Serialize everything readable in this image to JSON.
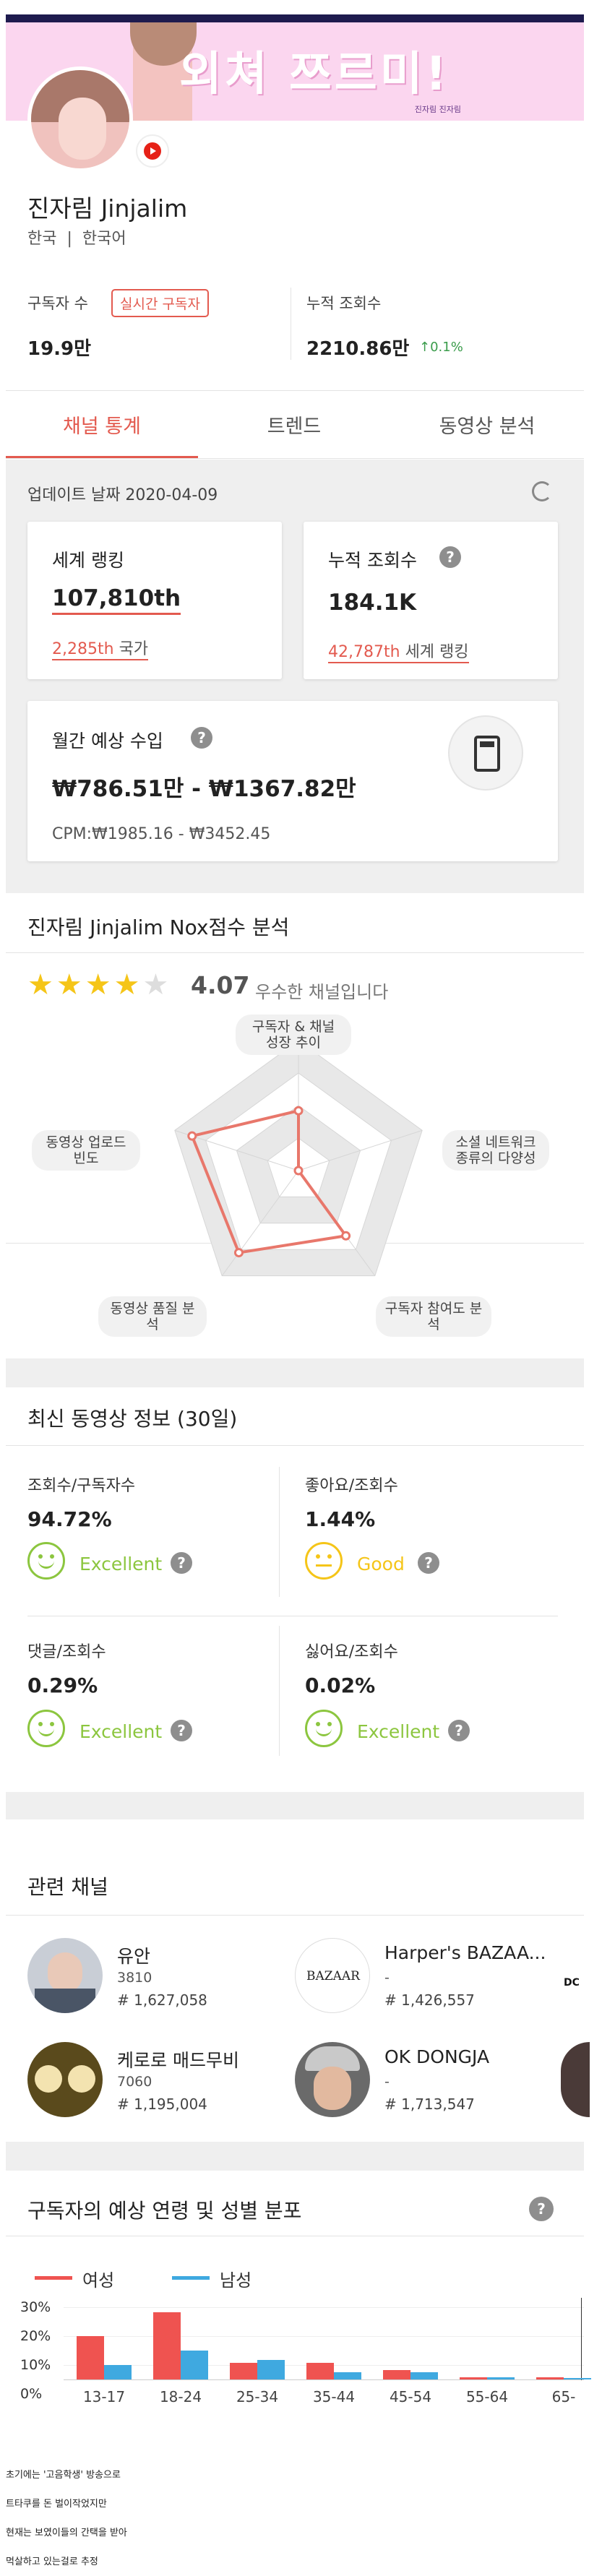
{
  "banner": {
    "title": "외쳐 쯔르미!",
    "social": "진자림 진자림"
  },
  "channel": {
    "name": "진자림 Jinjalim",
    "country": "한국",
    "language": "한국어"
  },
  "stats": {
    "subscribers_label": "구독자 수",
    "realtime_button": "실시간 구독자",
    "subscribers_value": "19.9만",
    "views_label": "누적 조회수",
    "views_value": "2210.86만",
    "views_growth": "0.1%"
  },
  "tabs": [
    "채널 통계",
    "트렌드",
    "동영상 분석"
  ],
  "overview": {
    "update_date": "업데이트 날짜 2020-04-09",
    "world_rank_title": "세계 랭킹",
    "world_rank_value": "107,810th",
    "country_rank_value": "2,285th",
    "country_rank_label": "국가",
    "views_title": "누적 조회수",
    "views_value": "184.1K",
    "views_rank_value": "42,787th",
    "views_rank_label": "세계 랭킹",
    "income_title": "월간 예상 수입",
    "income_value": "₩786.51만 - ₩1367.82만",
    "cpm": "CPM:₩1985.16 - ₩3452.45"
  },
  "nox": {
    "title": "진자림 Jinjalim Nox점수 분석",
    "stars": 4,
    "score": "4.07",
    "score_text": "우수한 채널입니다",
    "axes": [
      {
        "label": "구독자 & 채널 성장 추이",
        "value": 0.46
      },
      {
        "label": "소셜 네트워크 종류의 다양성",
        "value": 0.0
      },
      {
        "label": "구독자 참여도 분석",
        "value": 0.62
      },
      {
        "label": "동영상 품질 분석",
        "value": 0.78
      },
      {
        "label": "동영상 업로드 빈도",
        "value": 0.86
      }
    ]
  },
  "recent": {
    "title": "최신 동영상 정보 (30일)",
    "metrics": [
      {
        "label": "조회수/구독자수",
        "value": "94.72%",
        "grade": "Excellent"
      },
      {
        "label": "좋아요/조회수",
        "value": "1.44%",
        "grade": "Good"
      },
      {
        "label": "댓글/조회수",
        "value": "0.29%",
        "grade": "Excellent"
      },
      {
        "label": "싫어요/조회수",
        "value": "0.02%",
        "grade": "Excellent"
      }
    ]
  },
  "related": {
    "title": "관련 채널",
    "channels": [
      {
        "name": "유안",
        "count": "3810",
        "rank": "# 1,627,058"
      },
      {
        "name": "Harper's BAZAA...",
        "count": "-",
        "rank": "# 1,426,557"
      },
      {
        "name": "케로로 매드무비",
        "count": "7060",
        "rank": "# 1,195,004"
      },
      {
        "name": "OK DONGJA",
        "count": "-",
        "rank": "# 1,713,547"
      }
    ],
    "bazaar_logo": "BAZAAR",
    "edge_logo": "DC"
  },
  "demographics": {
    "title": "구독자의 예상 연령 및 성별 분포",
    "notes": [
      "초기에는 '고음학생' 방송으로",
      "트타쿠를 돈 벌이작었지만",
      "현재는 보였이들의 간택을 받아",
      "먹살하고 있는걸로 추정"
    ]
  },
  "chart_data": {
    "type": "bar",
    "categories": [
      "13-17",
      "18-24",
      "25-34",
      "35-44",
      "45-54",
      "55-64",
      "65-"
    ],
    "series": [
      {
        "name": "여성",
        "color": "#ef5350",
        "values": [
          18,
          28,
          7,
          7,
          4,
          1,
          1
        ]
      },
      {
        "name": "남성",
        "color": "#3fa9e0",
        "values": [
          6,
          12,
          8,
          3,
          3,
          1,
          0.5
        ]
      }
    ],
    "ylim": [
      0,
      30
    ],
    "yticks": [
      "30%",
      "20%",
      "10%",
      "0%"
    ]
  }
}
